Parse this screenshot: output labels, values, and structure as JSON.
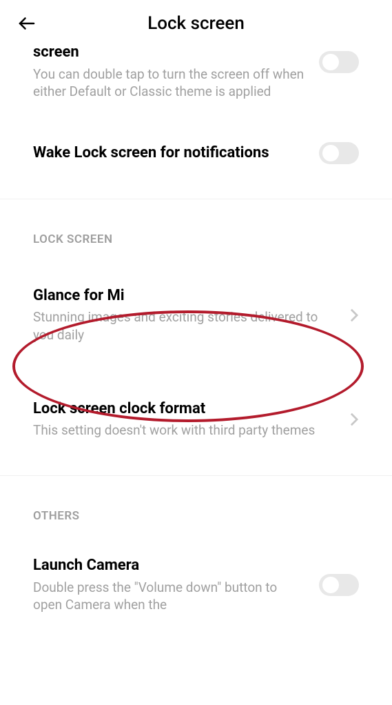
{
  "header": {
    "title": "Lock screen"
  },
  "items": {
    "doubleTap": {
      "title_partial": "screen",
      "desc": "You can double tap to turn the screen off when either Default or Classic theme is applied"
    },
    "wakeLock": {
      "title": "Wake Lock screen for notifications"
    },
    "glance": {
      "title": "Glance for Mi",
      "desc": "Stunning images and exciting stories delivered to you daily"
    },
    "clockFormat": {
      "title": "Lock screen clock format",
      "desc": "This setting doesn't work with third party themes"
    },
    "launchCamera": {
      "title": "Launch Camera",
      "desc": "Double press the \"Volume down\" button to open Camera when the"
    }
  },
  "sections": {
    "lockScreen": "LOCK SCREEN",
    "others": "OTHERS"
  }
}
